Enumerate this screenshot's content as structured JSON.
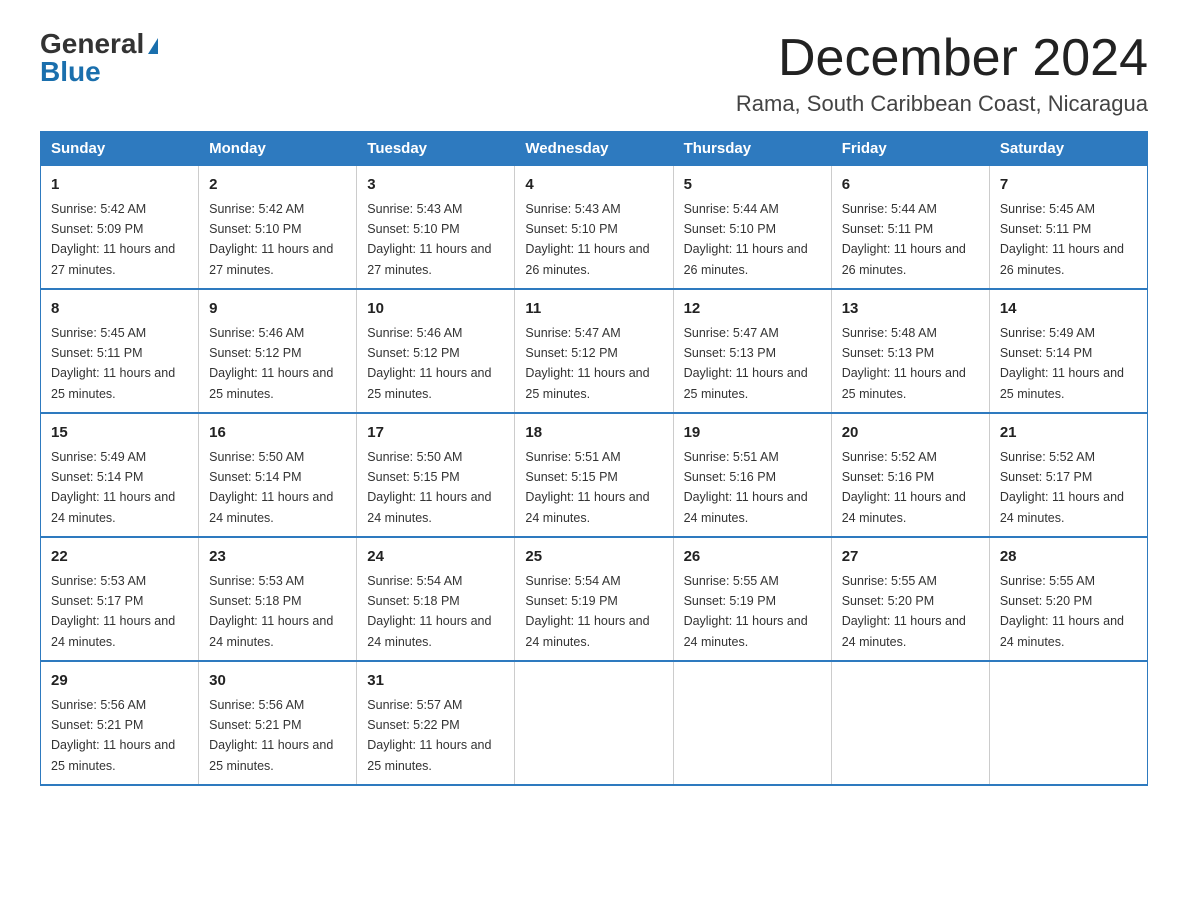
{
  "logo": {
    "general": "General",
    "blue": "Blue",
    "triangle": "▶"
  },
  "title": {
    "month_year": "December 2024",
    "location": "Rama, South Caribbean Coast, Nicaragua"
  },
  "weekdays": [
    "Sunday",
    "Monday",
    "Tuesday",
    "Wednesday",
    "Thursday",
    "Friday",
    "Saturday"
  ],
  "weeks": [
    [
      {
        "day": "1",
        "sunrise": "5:42 AM",
        "sunset": "5:09 PM",
        "daylight": "11 hours and 27 minutes."
      },
      {
        "day": "2",
        "sunrise": "5:42 AM",
        "sunset": "5:10 PM",
        "daylight": "11 hours and 27 minutes."
      },
      {
        "day": "3",
        "sunrise": "5:43 AM",
        "sunset": "5:10 PM",
        "daylight": "11 hours and 27 minutes."
      },
      {
        "day": "4",
        "sunrise": "5:43 AM",
        "sunset": "5:10 PM",
        "daylight": "11 hours and 26 minutes."
      },
      {
        "day": "5",
        "sunrise": "5:44 AM",
        "sunset": "5:10 PM",
        "daylight": "11 hours and 26 minutes."
      },
      {
        "day": "6",
        "sunrise": "5:44 AM",
        "sunset": "5:11 PM",
        "daylight": "11 hours and 26 minutes."
      },
      {
        "day": "7",
        "sunrise": "5:45 AM",
        "sunset": "5:11 PM",
        "daylight": "11 hours and 26 minutes."
      }
    ],
    [
      {
        "day": "8",
        "sunrise": "5:45 AM",
        "sunset": "5:11 PM",
        "daylight": "11 hours and 25 minutes."
      },
      {
        "day": "9",
        "sunrise": "5:46 AM",
        "sunset": "5:12 PM",
        "daylight": "11 hours and 25 minutes."
      },
      {
        "day": "10",
        "sunrise": "5:46 AM",
        "sunset": "5:12 PM",
        "daylight": "11 hours and 25 minutes."
      },
      {
        "day": "11",
        "sunrise": "5:47 AM",
        "sunset": "5:12 PM",
        "daylight": "11 hours and 25 minutes."
      },
      {
        "day": "12",
        "sunrise": "5:47 AM",
        "sunset": "5:13 PM",
        "daylight": "11 hours and 25 minutes."
      },
      {
        "day": "13",
        "sunrise": "5:48 AM",
        "sunset": "5:13 PM",
        "daylight": "11 hours and 25 minutes."
      },
      {
        "day": "14",
        "sunrise": "5:49 AM",
        "sunset": "5:14 PM",
        "daylight": "11 hours and 25 minutes."
      }
    ],
    [
      {
        "day": "15",
        "sunrise": "5:49 AM",
        "sunset": "5:14 PM",
        "daylight": "11 hours and 24 minutes."
      },
      {
        "day": "16",
        "sunrise": "5:50 AM",
        "sunset": "5:14 PM",
        "daylight": "11 hours and 24 minutes."
      },
      {
        "day": "17",
        "sunrise": "5:50 AM",
        "sunset": "5:15 PM",
        "daylight": "11 hours and 24 minutes."
      },
      {
        "day": "18",
        "sunrise": "5:51 AM",
        "sunset": "5:15 PM",
        "daylight": "11 hours and 24 minutes."
      },
      {
        "day": "19",
        "sunrise": "5:51 AM",
        "sunset": "5:16 PM",
        "daylight": "11 hours and 24 minutes."
      },
      {
        "day": "20",
        "sunrise": "5:52 AM",
        "sunset": "5:16 PM",
        "daylight": "11 hours and 24 minutes."
      },
      {
        "day": "21",
        "sunrise": "5:52 AM",
        "sunset": "5:17 PM",
        "daylight": "11 hours and 24 minutes."
      }
    ],
    [
      {
        "day": "22",
        "sunrise": "5:53 AM",
        "sunset": "5:17 PM",
        "daylight": "11 hours and 24 minutes."
      },
      {
        "day": "23",
        "sunrise": "5:53 AM",
        "sunset": "5:18 PM",
        "daylight": "11 hours and 24 minutes."
      },
      {
        "day": "24",
        "sunrise": "5:54 AM",
        "sunset": "5:18 PM",
        "daylight": "11 hours and 24 minutes."
      },
      {
        "day": "25",
        "sunrise": "5:54 AM",
        "sunset": "5:19 PM",
        "daylight": "11 hours and 24 minutes."
      },
      {
        "day": "26",
        "sunrise": "5:55 AM",
        "sunset": "5:19 PM",
        "daylight": "11 hours and 24 minutes."
      },
      {
        "day": "27",
        "sunrise": "5:55 AM",
        "sunset": "5:20 PM",
        "daylight": "11 hours and 24 minutes."
      },
      {
        "day": "28",
        "sunrise": "5:55 AM",
        "sunset": "5:20 PM",
        "daylight": "11 hours and 24 minutes."
      }
    ],
    [
      {
        "day": "29",
        "sunrise": "5:56 AM",
        "sunset": "5:21 PM",
        "daylight": "11 hours and 25 minutes."
      },
      {
        "day": "30",
        "sunrise": "5:56 AM",
        "sunset": "5:21 PM",
        "daylight": "11 hours and 25 minutes."
      },
      {
        "day": "31",
        "sunrise": "5:57 AM",
        "sunset": "5:22 PM",
        "daylight": "11 hours and 25 minutes."
      },
      null,
      null,
      null,
      null
    ]
  ],
  "labels": {
    "sunrise": "Sunrise:",
    "sunset": "Sunset:",
    "daylight": "Daylight:"
  }
}
